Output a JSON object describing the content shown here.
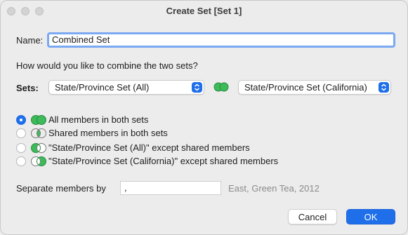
{
  "window": {
    "title": "Create Set [Set 1]"
  },
  "name": {
    "label": "Name:",
    "value": "Combined Set"
  },
  "question": "How would you like to combine the two sets?",
  "sets": {
    "label": "Sets:",
    "left": "State/Province Set (All)",
    "right": "State/Province Set (California)"
  },
  "options": [
    {
      "text": "All members in both sets",
      "selected": true,
      "venn": "union-icon"
    },
    {
      "text": "Shared members in both sets",
      "selected": false,
      "venn": "intersection-icon"
    },
    {
      "text": "\"State/Province Set (All)\" except shared members",
      "selected": false,
      "venn": "left-except-icon"
    },
    {
      "text": "\"State/Province Set (California)\" except shared members",
      "selected": false,
      "venn": "right-except-icon"
    }
  ],
  "separator": {
    "label": "Separate members by",
    "value": ",",
    "example": "East, Green Tea, 2012"
  },
  "buttons": {
    "cancel": "Cancel",
    "ok": "OK"
  },
  "colors": {
    "accent": "#1f6feb",
    "venn_green": "#3dbb5a"
  }
}
